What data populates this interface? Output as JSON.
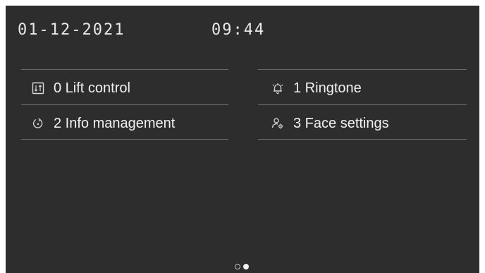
{
  "status_bar": {
    "date": "01-12-2021",
    "time": "09:44"
  },
  "menu": {
    "items": [
      {
        "number": "0",
        "label": "0 Lift control",
        "icon": "lift-icon"
      },
      {
        "number": "1",
        "label": "1 Ringtone",
        "icon": "bell-icon"
      },
      {
        "number": "2",
        "label": "2 Info management",
        "icon": "info-management-icon"
      },
      {
        "number": "3",
        "label": "3 Face settings",
        "icon": "face-settings-icon"
      }
    ]
  },
  "pager": {
    "pages": 2,
    "current_page": 2
  },
  "colors": {
    "background": "#2d2d2d",
    "text": "#f1f1f1",
    "divider": "#6a6a6a"
  }
}
